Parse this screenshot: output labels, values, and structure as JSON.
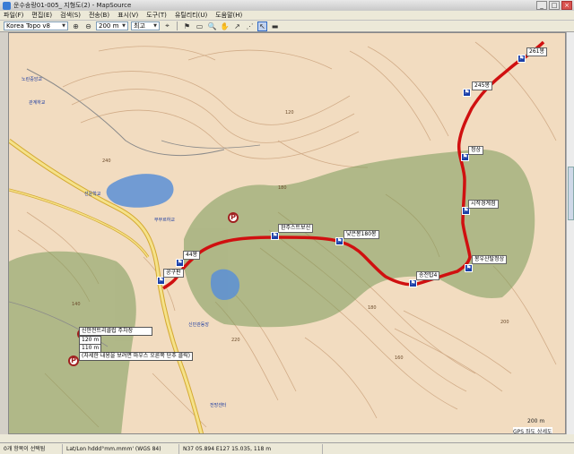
{
  "window": {
    "title": "운수송랑01-005_ 지형도(2) - MapSource",
    "buttons": [
      "_",
      "□",
      "×"
    ]
  },
  "menu": {
    "items": [
      "파일(F)",
      "편집(E)",
      "검색(S)",
      "전송(B)",
      "표시(V)",
      "도구(T)",
      "유틸리티(U)",
      "도움말(H)"
    ]
  },
  "toolbar": {
    "map_product": "Korea Topo v8",
    "zoom_level": "200 m",
    "detail": "최고"
  },
  "waypoints": [
    {
      "label": "261봉"
    },
    {
      "label": "245봉"
    },
    {
      "label": "정상"
    },
    {
      "label": "시작경계점"
    },
    {
      "label": "봉우산탈정상"
    },
    {
      "label": "송전탑4"
    },
    {
      "label": "낮은봉180봉"
    },
    {
      "label": "완주스트보선"
    },
    {
      "label": "44봉"
    },
    {
      "label": "공구판"
    }
  ],
  "place_labels": [
    "노린중앙교",
    "관계하교",
    "선운학교",
    "부부르하교",
    "신민관동앙",
    "전망센터"
  ],
  "elevations": [
    "120",
    "180",
    "220",
    "140",
    "160",
    "180",
    "200",
    "240"
  ],
  "parking_popup": {
    "name": "신안전트리클럽 주차장",
    "distance": "120 m",
    "bearing": "110 m",
    "hint": "(자세한 내용을 보려면 마우스 오른쪽 단추 클릭)"
  },
  "scale": {
    "label": "200 m"
  },
  "map_credit": "GPS 좌도 상세도",
  "status": {
    "selection": "0개 항목이 선택됨",
    "format": "Lat/Lon hddd°mm.mmm' (WGS 84)",
    "coords": "N37 05.894 E127 15.035, 118 m"
  },
  "colors": {
    "terrain": "#f2dcc0",
    "forest": "#7a9a5a",
    "water": "#5b8fd6",
    "track": "#d01010",
    "contour": "#c9a07a"
  }
}
